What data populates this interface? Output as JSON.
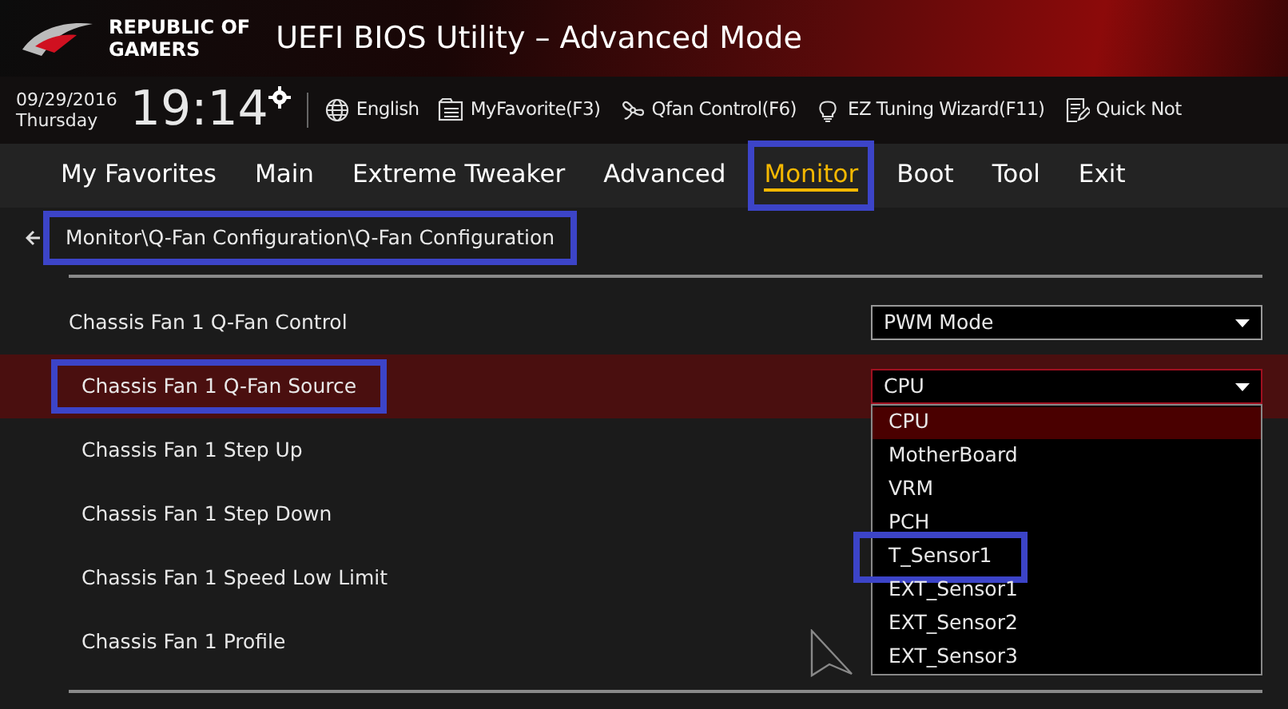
{
  "brand": {
    "line_1": "REPUBLIC OF",
    "line_2": "GAMERS"
  },
  "window": {
    "title": "UEFI BIOS Utility – Advanced Mode"
  },
  "clock": {
    "date": "09/29/2016",
    "weekday": "Thursday",
    "time": "19:14"
  },
  "toolbar": [
    {
      "kind": "language",
      "label": "English"
    },
    {
      "kind": "favorite",
      "label": "MyFavorite(F3)"
    },
    {
      "kind": "fan",
      "label": "Qfan Control(F6)"
    },
    {
      "kind": "wizard",
      "label": "EZ Tuning Wizard(F11)"
    },
    {
      "kind": "note",
      "label": "Quick Not"
    }
  ],
  "tabs": [
    {
      "label": "My Favorites",
      "selected": false,
      "highlighted": false
    },
    {
      "label": "Main",
      "selected": false,
      "highlighted": false
    },
    {
      "label": "Extreme Tweaker",
      "selected": false,
      "highlighted": false
    },
    {
      "label": "Advanced",
      "selected": false,
      "highlighted": false
    },
    {
      "label": "Monitor",
      "selected": true,
      "highlighted": true
    },
    {
      "label": "Boot",
      "selected": false,
      "highlighted": false
    },
    {
      "label": "Tool",
      "selected": false,
      "highlighted": false
    },
    {
      "label": "Exit",
      "selected": false,
      "highlighted": false
    }
  ],
  "breadcrumb": {
    "path": "Monitor\\Q-Fan Configuration\\Q-Fan Configuration",
    "highlighted": true
  },
  "settings": [
    {
      "label": "Chassis Fan 1 Q-Fan Control",
      "selected": false,
      "highlighted": false,
      "value": "PWM Mode"
    },
    {
      "label": "Chassis Fan 1 Q-Fan Source",
      "selected": true,
      "highlighted": true,
      "value": "CPU"
    },
    {
      "label": "Chassis Fan 1 Step Up",
      "selected": false,
      "highlighted": false
    },
    {
      "label": "Chassis Fan 1 Step Down",
      "selected": false,
      "highlighted": false
    },
    {
      "label": "Chassis Fan 1 Speed Low Limit",
      "selected": false,
      "highlighted": false
    },
    {
      "label": "Chassis Fan 1 Profile",
      "selected": false,
      "highlighted": false
    }
  ],
  "dropdown_options": [
    {
      "label": "CPU",
      "selected": true,
      "highlighted": false
    },
    {
      "label": "MotherBoard",
      "selected": false,
      "highlighted": false
    },
    {
      "label": "VRM",
      "selected": false,
      "highlighted": false
    },
    {
      "label": "PCH",
      "selected": false,
      "highlighted": false
    },
    {
      "label": "T_Sensor1",
      "selected": false,
      "highlighted": true
    },
    {
      "label": "EXT_Sensor1",
      "selected": false,
      "highlighted": false
    },
    {
      "label": "EXT_Sensor2",
      "selected": false,
      "highlighted": false
    },
    {
      "label": "EXT_Sensor3",
      "selected": false,
      "highlighted": false
    }
  ]
}
